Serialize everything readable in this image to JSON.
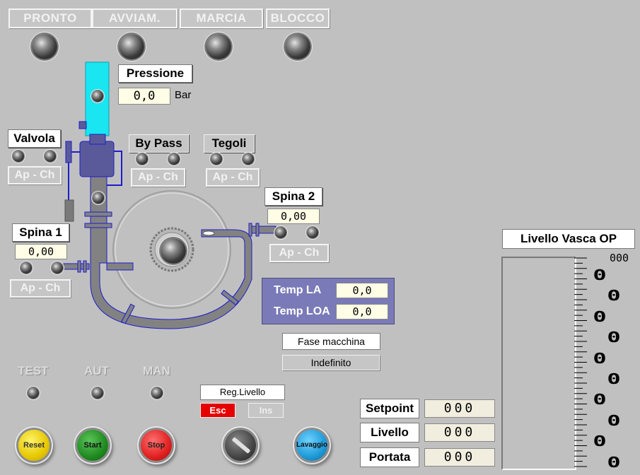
{
  "header": {
    "pronto": "PRONTO",
    "avviam": "AVVIAM.",
    "marcia": "MARCIA",
    "blocco": "BLOCCO"
  },
  "pressione": {
    "label": "Pressione",
    "value": "0,0",
    "unit": "Bar"
  },
  "valvola": {
    "label": "Valvola",
    "state": "Ap - Ch"
  },
  "bypass": {
    "label": "By Pass",
    "state": "Ap - Ch"
  },
  "tegoli": {
    "label": "Tegoli",
    "state": "Ap - Ch"
  },
  "spina1": {
    "label": "Spina 1",
    "value": "0,00",
    "state": "Ap - Ch"
  },
  "spina2": {
    "label": "Spina 2",
    "value": "0,00",
    "state": "Ap - Ch"
  },
  "temp": {
    "la_label": "Temp LA",
    "la_value": "0,0",
    "loa_label": "Temp LOA",
    "loa_value": "0,0"
  },
  "fase": {
    "label": "Fase macchina",
    "value": "Indefinito"
  },
  "modes": {
    "test": "TEST",
    "aut": "AUT",
    "man": "MAN"
  },
  "regLivello": {
    "label": "Reg.Livello",
    "esc": "Esc",
    "ins": "Ins"
  },
  "buttons": {
    "reset": "Reset",
    "start": "Start",
    "stop": "Stop",
    "lavaggio": "Lavaggio"
  },
  "side": {
    "setpoint_label": "Setpoint",
    "setpoint_value": "000",
    "livello_label": "Livello",
    "livello_value": "000",
    "portata_label": "Portata",
    "portata_value": "000"
  },
  "vasca": {
    "title": "Livello Vasca OP",
    "top_value": "000",
    "scale": [
      "0",
      "0",
      "0",
      "0",
      "0",
      "0",
      "0",
      "0",
      "0",
      "0"
    ]
  },
  "colors": {
    "tube": "#828282",
    "column": "#19e6f0",
    "valve": "#5a5a9a",
    "esc": "#e60000"
  }
}
